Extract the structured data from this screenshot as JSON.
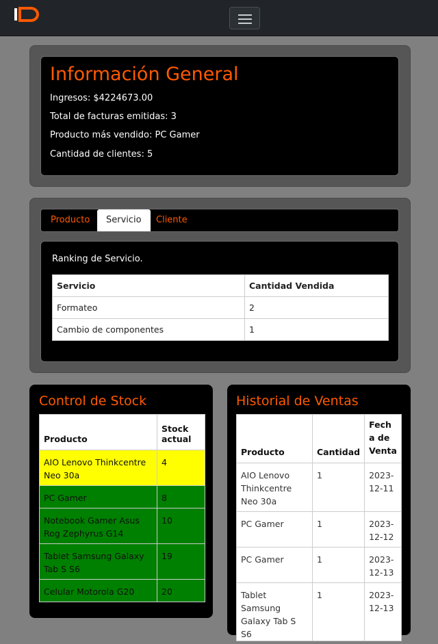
{
  "navbar": {
    "logo_text": "ID",
    "menu_icon": "hamburger-menu-icon"
  },
  "info": {
    "title": "Información General",
    "lines": [
      "Ingresos: $4224673.00",
      "Total de facturas emitidas: 3",
      "Producto más vendido: PC Gamer",
      "Cantidad de clientes: 5"
    ]
  },
  "tabs": [
    {
      "label": "Producto",
      "active": false
    },
    {
      "label": "Servicio",
      "active": true
    },
    {
      "label": "Cliente",
      "active": false
    }
  ],
  "ranking": {
    "title": "Ranking de Servicio.",
    "headers": [
      "Servicio",
      "Cantidad Vendida"
    ],
    "rows": [
      [
        "Formateo",
        "2"
      ],
      [
        "Cambio de componentes",
        "1"
      ]
    ]
  },
  "stock": {
    "title": "Control de Stock",
    "headers": [
      "Producto",
      "Stock actual"
    ],
    "rows": [
      {
        "product": "AIO Lenovo Thinkcentre Neo 30a",
        "stock": "4",
        "status": "low"
      },
      {
        "product": "PC Gamer",
        "stock": "8",
        "status": "ok"
      },
      {
        "product": "Notebook Gamer Asus Rog Zephyrus G14",
        "stock": "10",
        "status": "ok"
      },
      {
        "product": "Tablet Samsung Galaxy Tab S S6",
        "stock": "19",
        "status": "ok"
      },
      {
        "product": "Celular Motorola G20",
        "stock": "20",
        "status": "ok"
      }
    ],
    "colors": {
      "low": "#ffff00",
      "ok": "#008000"
    }
  },
  "history": {
    "title": "Historial de Ventas",
    "headers": [
      "Producto",
      "Cantidad",
      "Fecha de Venta"
    ],
    "rows": [
      [
        "AIO Lenovo Thinkcentre Neo 30a",
        "1",
        "2023-12-11"
      ],
      [
        "PC Gamer",
        "1",
        "2023-12-12"
      ],
      [
        "PC Gamer",
        "1",
        "2023-12-13"
      ],
      [
        "Tablet Samsung Galaxy Tab S S6",
        "1",
        "2023-12-13"
      ]
    ]
  },
  "colors": {
    "accent": "#ff5a00",
    "background": "#808080",
    "panel": "#000000"
  }
}
